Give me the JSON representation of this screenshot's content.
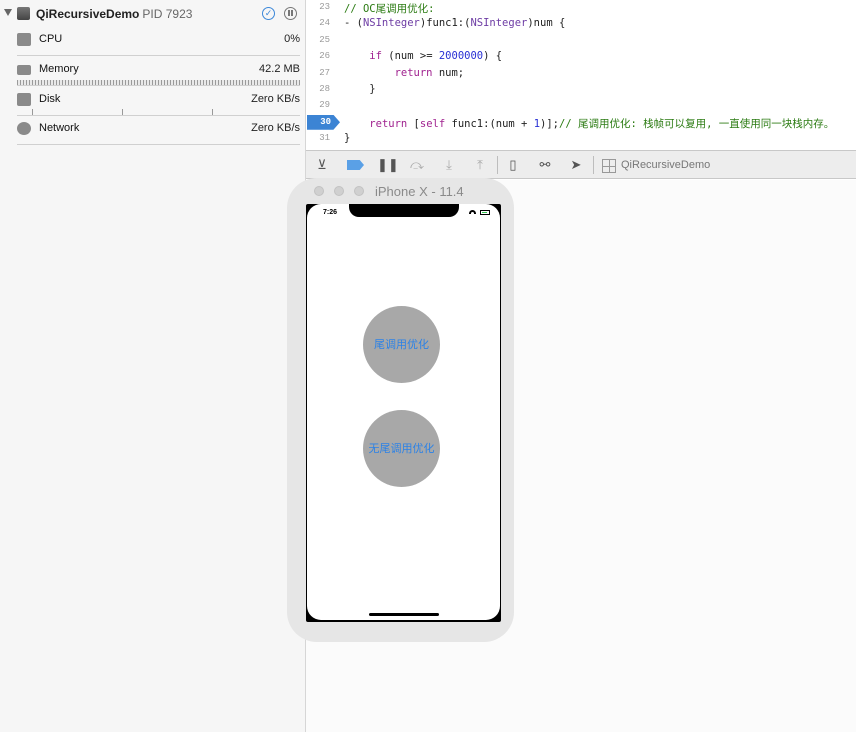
{
  "navigator": {
    "process_name": "QiRecursiveDemo",
    "pid_text": "PID 7923",
    "gauges": [
      {
        "label": "CPU",
        "value": "0%",
        "icon": "cpu-icon"
      },
      {
        "label": "Memory",
        "value": "42.2 MB",
        "icon": "memory-icon"
      },
      {
        "label": "Disk",
        "value": "Zero KB/s",
        "icon": "disk-icon"
      },
      {
        "label": "Network",
        "value": "Zero KB/s",
        "icon": "network-icon"
      }
    ]
  },
  "editor": {
    "current_line": 30,
    "lines": [
      {
        "n": "23",
        "parts": [
          {
            "t": "// OC尾调用优化:",
            "c": "cm"
          }
        ]
      },
      {
        "n": "24",
        "parts": [
          {
            "t": "- (",
            "c": ""
          },
          {
            "t": "NSInteger",
            "c": "tp"
          },
          {
            "t": ")func1:(",
            "c": ""
          },
          {
            "t": "NSInteger",
            "c": "tp"
          },
          {
            "t": ")num {",
            "c": ""
          }
        ]
      },
      {
        "n": "25",
        "parts": []
      },
      {
        "n": "26",
        "parts": [
          {
            "t": "    ",
            "c": ""
          },
          {
            "t": "if",
            "c": "kw"
          },
          {
            "t": " (num >= ",
            "c": ""
          },
          {
            "t": "2000000",
            "c": "num"
          },
          {
            "t": ") {",
            "c": ""
          }
        ]
      },
      {
        "n": "27",
        "parts": [
          {
            "t": "        ",
            "c": ""
          },
          {
            "t": "return",
            "c": "kw"
          },
          {
            "t": " num;",
            "c": ""
          }
        ]
      },
      {
        "n": "28",
        "parts": [
          {
            "t": "    }",
            "c": ""
          }
        ]
      },
      {
        "n": "29",
        "parts": []
      },
      {
        "n": "30",
        "parts": [
          {
            "t": "    ",
            "c": ""
          },
          {
            "t": "return",
            "c": "kw"
          },
          {
            "t": " [",
            "c": ""
          },
          {
            "t": "self",
            "c": "kw"
          },
          {
            "t": " func1:(num + ",
            "c": ""
          },
          {
            "t": "1",
            "c": "num"
          },
          {
            "t": ")];",
            "c": ""
          },
          {
            "t": "// 尾调用优化: 栈帧可以复用, 一直使用同一块栈内存。",
            "c": "cm"
          }
        ]
      },
      {
        "n": "31",
        "parts": [
          {
            "t": "}",
            "c": ""
          }
        ]
      }
    ]
  },
  "debug_bar": {
    "target": "QiRecursiveDemo"
  },
  "simulator": {
    "title": "iPhone X - 11.4",
    "status_time": "7:26",
    "buttons": [
      "尾调用优化",
      "无尾调用优化"
    ]
  }
}
